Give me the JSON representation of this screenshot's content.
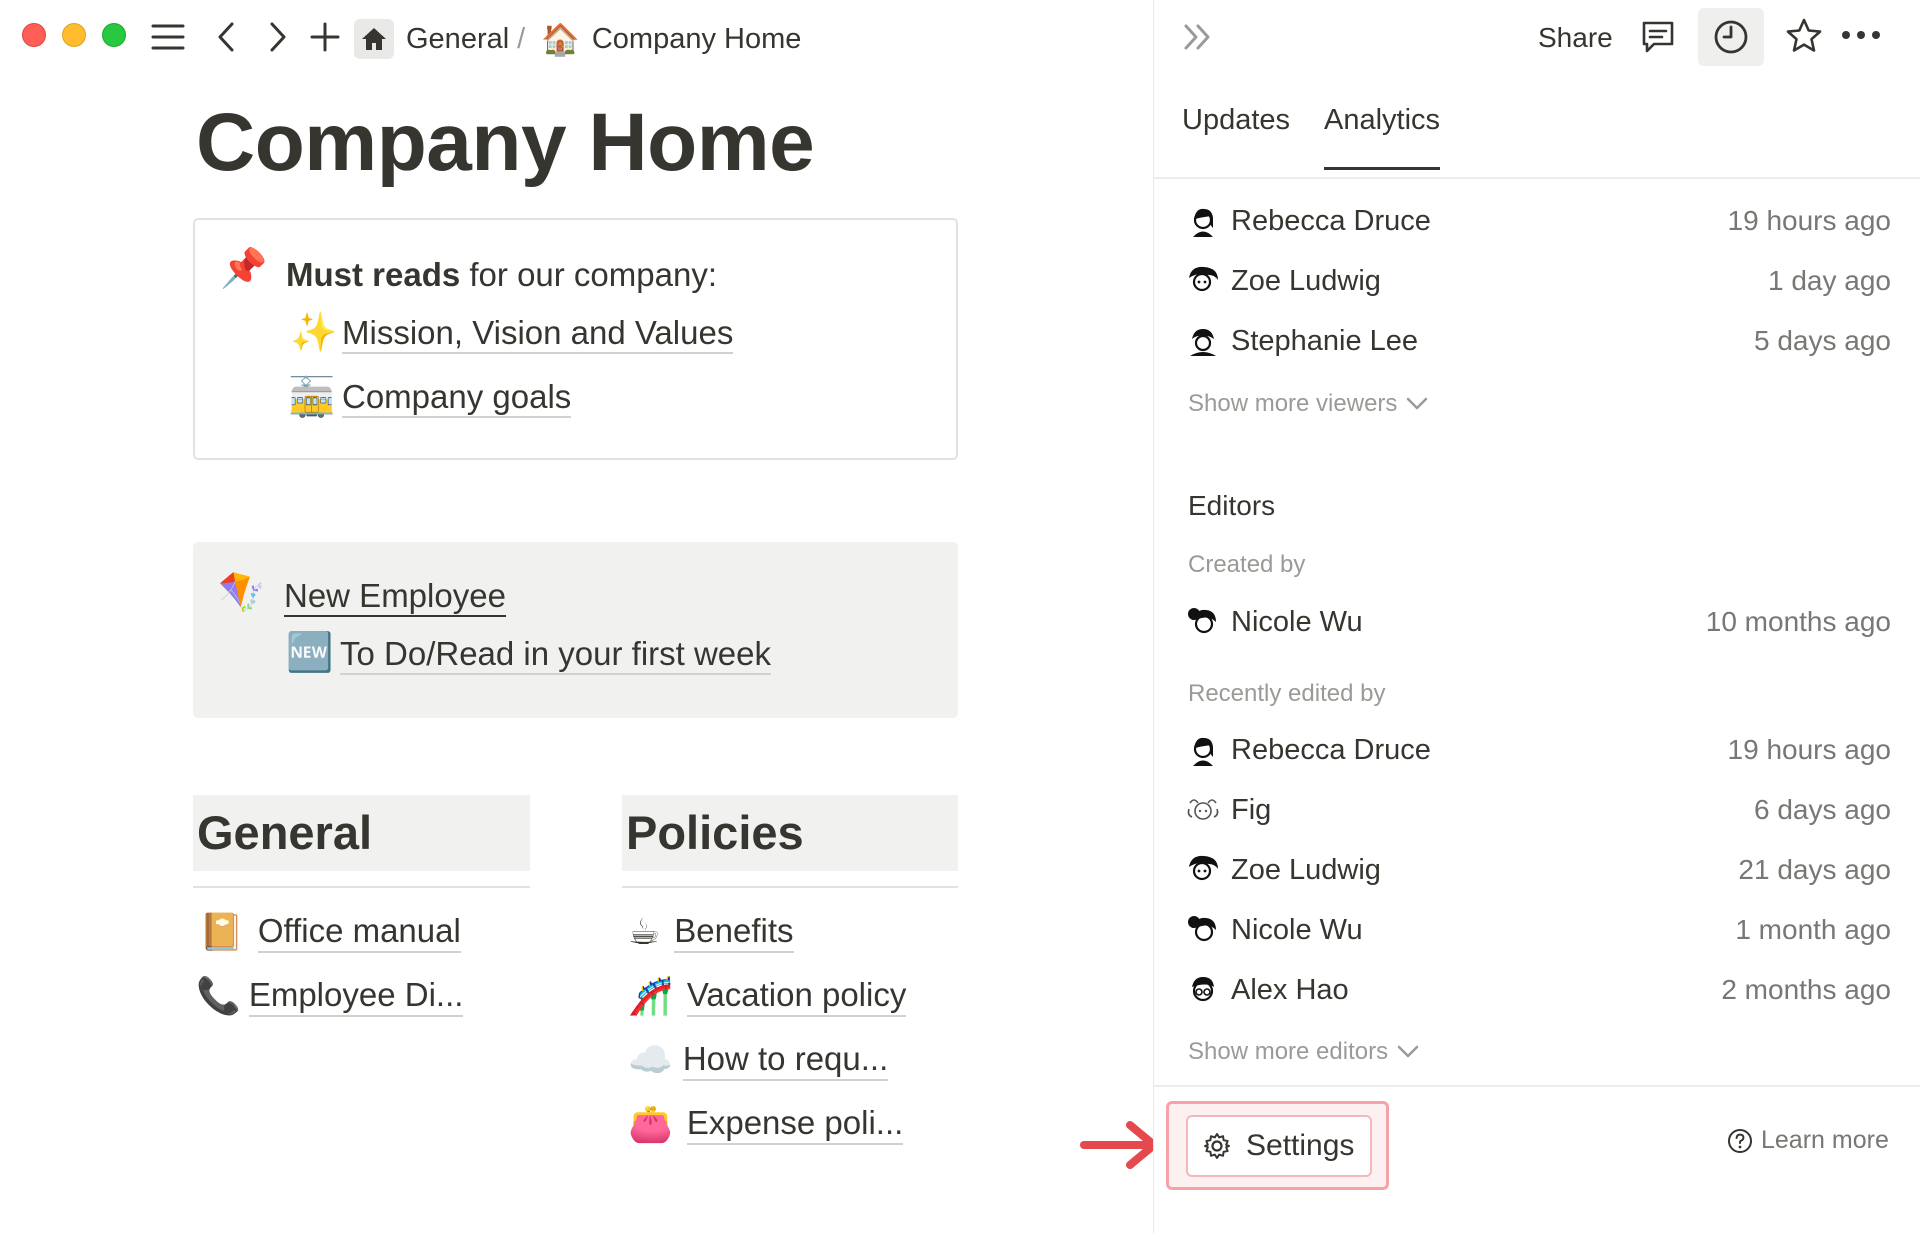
{
  "topbar": {
    "breadcrumb": {
      "parent": "General",
      "separator": "/",
      "current_emoji": "🏠",
      "current": "Company Home"
    }
  },
  "page": {
    "title": "Company Home",
    "callout_must_reads": {
      "icon": "📌",
      "heading_bold": "Must reads",
      "heading_rest": " for our company:",
      "links": [
        {
          "emoji": "✨",
          "label": "Mission, Vision and Values"
        },
        {
          "emoji": "🚋",
          "label": "Company goals"
        }
      ]
    },
    "callout_new_employee": {
      "icon": "🪁",
      "title": "New Employee",
      "links": [
        {
          "emoji": "🆕",
          "label": "To Do/Read in your first week"
        }
      ]
    },
    "sections": {
      "general": {
        "title": "General",
        "items": [
          {
            "emoji": "📔",
            "label": "Office manual"
          },
          {
            "emoji": "📞",
            "label": "Employee Di..."
          }
        ]
      },
      "policies": {
        "title": "Policies",
        "items": [
          {
            "emoji": "☕",
            "label": "Benefits"
          },
          {
            "emoji": "🎢",
            "label": "Vacation policy"
          },
          {
            "emoji": "☁️",
            "label": "How to requ..."
          },
          {
            "emoji": "👛",
            "label": "Expense poli..."
          }
        ]
      }
    }
  },
  "panel": {
    "share_label": "Share",
    "tabs": [
      {
        "label": "Updates",
        "active": false
      },
      {
        "label": "Analytics",
        "active": true
      }
    ],
    "viewers": [
      {
        "name": "Rebecca Druce",
        "time": "19 hours ago"
      },
      {
        "name": "Zoe Ludwig",
        "time": "1 day ago"
      },
      {
        "name": "Stephanie Lee",
        "time": "5 days ago"
      }
    ],
    "show_more_viewers": "Show more viewers",
    "editors_heading": "Editors",
    "created_by_label": "Created by",
    "created_by": {
      "name": "Nicole Wu",
      "time": "10 months ago"
    },
    "recently_edited_label": "Recently edited by",
    "recent_editors": [
      {
        "name": "Rebecca Druce",
        "time": "19 hours ago"
      },
      {
        "name": "Fig",
        "time": "6 days ago"
      },
      {
        "name": "Zoe Ludwig",
        "time": "21 days ago"
      },
      {
        "name": "Nicole Wu",
        "time": "1 month ago"
      },
      {
        "name": "Alex Hao",
        "time": "2 months ago"
      }
    ],
    "show_more_editors": "Show more editors",
    "settings_label": "Settings",
    "learn_more_label": "Learn more"
  },
  "colors": {
    "text": "#37352f",
    "muted": "#9b9a97",
    "highlight_border": "#f5a3a8",
    "arrow": "#e5484d"
  }
}
